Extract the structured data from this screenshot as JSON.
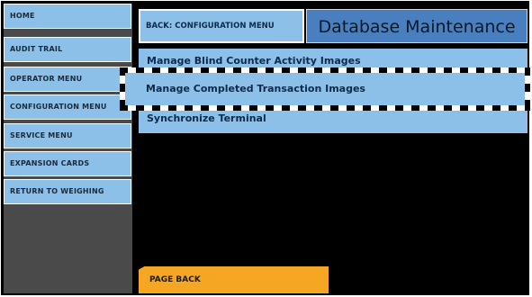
{
  "sidebar": {
    "items": [
      {
        "label": "HOME"
      },
      {
        "label": "AUDIT TRAIL"
      },
      {
        "label": "OPERATOR MENU"
      },
      {
        "label": "CONFIGURATION MENU"
      },
      {
        "label": "SERVICE MENU"
      },
      {
        "label": "EXPANSION CARDS"
      },
      {
        "label": "RETURN TO WEIGHING"
      }
    ]
  },
  "header": {
    "back_label": "BACK: CONFIGURATION MENU",
    "title": "Database Maintenance"
  },
  "menu": {
    "items": [
      {
        "label": "Manage Blind Counter Activity Images"
      },
      {
        "label": "Manage Completed Transaction Images"
      },
      {
        "label": "Synchronize Terminal"
      }
    ]
  },
  "footer": {
    "page_back_label": "PAGE BACK"
  },
  "colors": {
    "button_blue": "#8cc0e8",
    "title_blue": "#4a7fbf",
    "page_back_orange": "#f5a623",
    "sidebar_gray": "#4a4a4a",
    "background": "#000000"
  }
}
